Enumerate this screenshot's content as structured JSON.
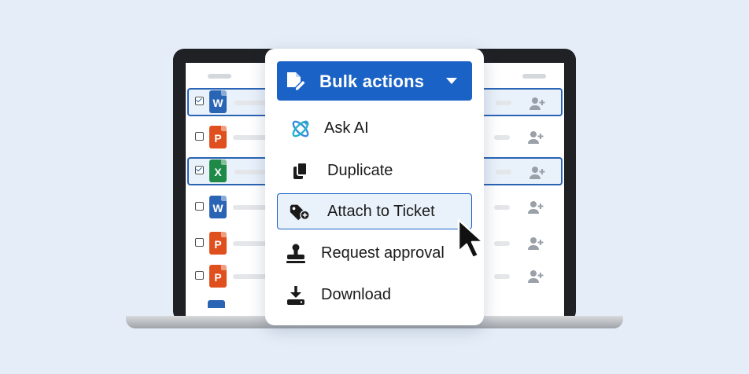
{
  "menu": {
    "button_label": "Bulk actions",
    "items": [
      {
        "label": "Ask AI",
        "icon": "ai-sparkle-icon"
      },
      {
        "label": "Duplicate",
        "icon": "duplicate-icon"
      },
      {
        "label": "Attach to Ticket",
        "icon": "ticket-tag-icon",
        "highlighted": true
      },
      {
        "label": "Request approval",
        "icon": "stamp-icon"
      },
      {
        "label": "Download",
        "icon": "download-icon"
      }
    ]
  },
  "files": [
    {
      "type": "word",
      "letter": "W",
      "selected": true
    },
    {
      "type": "powerpoint",
      "letter": "P",
      "selected": false
    },
    {
      "type": "excel",
      "letter": "X",
      "selected": true
    },
    {
      "type": "word",
      "letter": "W",
      "selected": false
    },
    {
      "type": "powerpoint",
      "letter": "P",
      "selected": false
    },
    {
      "type": "powerpoint",
      "letter": "P",
      "selected": false
    }
  ],
  "colors": {
    "accent": "#1a62c6",
    "background": "#e5eef8",
    "word": "#2a64b4",
    "powerpoint": "#e0501e",
    "excel": "#1f8a48"
  }
}
